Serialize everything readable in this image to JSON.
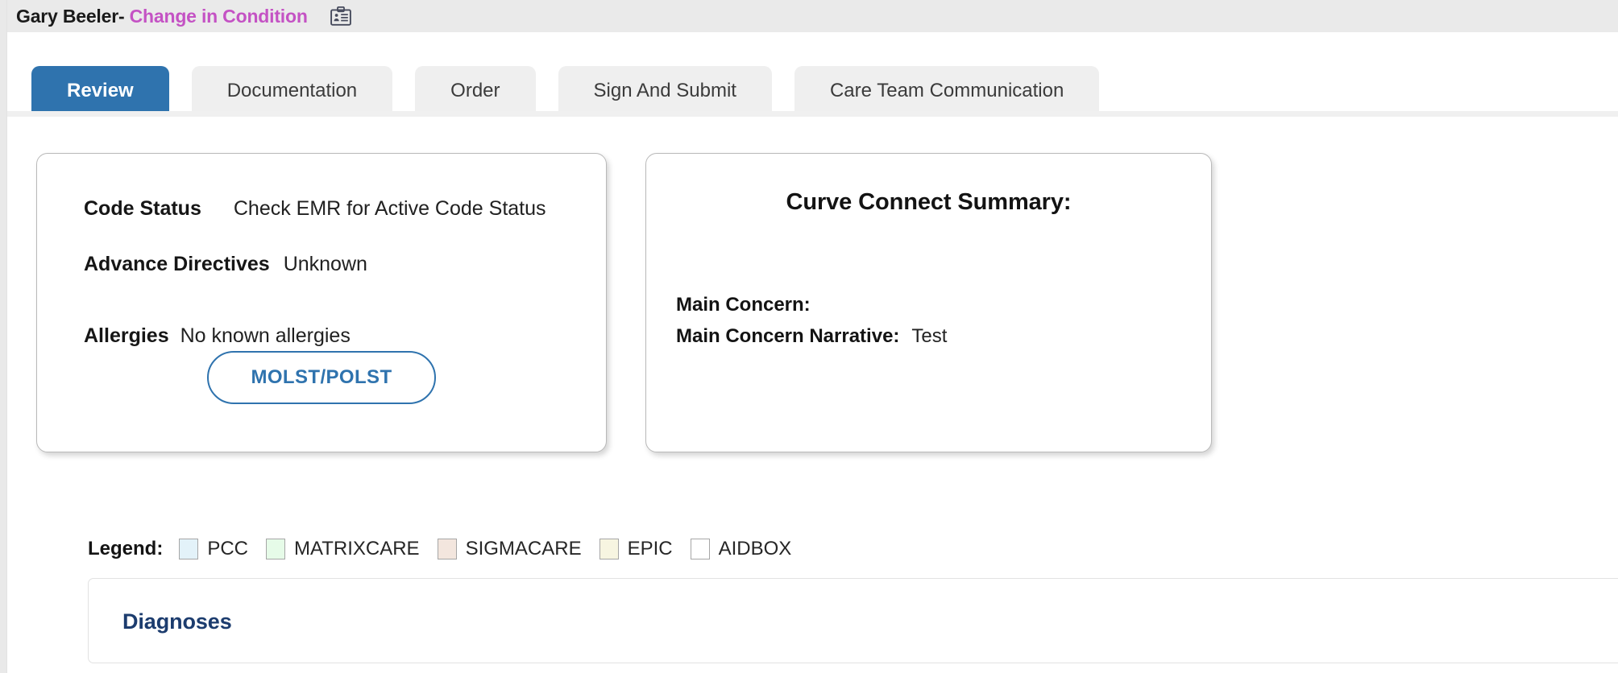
{
  "header": {
    "patient_name": "Gary Beeler",
    "separator": "-",
    "encounter_type": "Change in Condition",
    "badge_icon": "id-badge-icon"
  },
  "tabs": [
    {
      "label": "Review",
      "active": true
    },
    {
      "label": "Documentation",
      "active": false
    },
    {
      "label": "Order",
      "active": false
    },
    {
      "label": "Sign And Submit",
      "active": false
    },
    {
      "label": "Care Team Communication",
      "active": false
    }
  ],
  "patient_card": {
    "code_status_label": "Code Status",
    "code_status_value": "Check EMR for Active Code Status",
    "advance_directives_label": "Advance Directives",
    "advance_directives_value": "Unknown",
    "allergies_label": "Allergies",
    "allergies_value": "No known allergies",
    "molst_button": "MOLST/POLST"
  },
  "summary_card": {
    "title": "Curve Connect Summary:",
    "main_concern_label": "Main Concern:",
    "main_concern_value": "",
    "main_concern_narrative_label": "Main Concern Narrative:",
    "main_concern_narrative_value": "Test"
  },
  "legend": {
    "title": "Legend:",
    "items": [
      {
        "label": "PCC",
        "color": "#e3f2f9"
      },
      {
        "label": "MATRIXCARE",
        "color": "#e6fbe8"
      },
      {
        "label": "SIGMACARE",
        "color": "#f3e6de"
      },
      {
        "label": "EPIC",
        "color": "#f7f5e1"
      },
      {
        "label": "AIDBOX",
        "color": "#ffffff"
      }
    ]
  },
  "diagnoses_panel": {
    "title": "Diagnoses"
  },
  "colors": {
    "accent_magenta": "#c452c4",
    "tab_active_blue": "#2f73ae",
    "panel_title_navy": "#1c3c6e",
    "header_bg": "#eaeaea"
  }
}
